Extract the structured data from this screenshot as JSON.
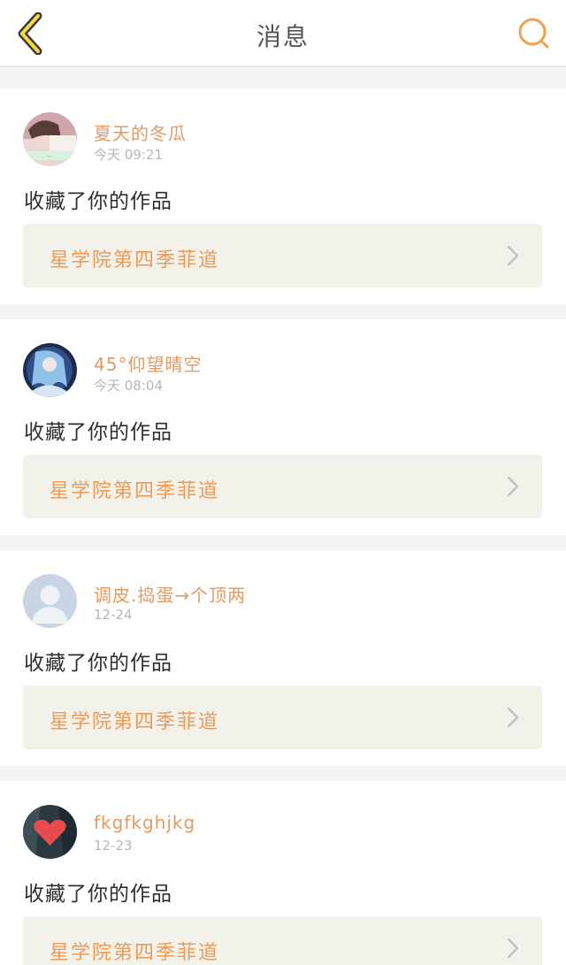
{
  "header": {
    "title": "消息",
    "back_icon": "chevron-left-icon",
    "search_icon": "search-icon",
    "accent_color": "#f2a04e"
  },
  "messages": [
    {
      "username": "夏天的冬瓜",
      "time": "今天 09:21",
      "action": "收藏了你的作品",
      "work_title": "星学院第四季菲道",
      "avatar": "photo-girl"
    },
    {
      "username": "45°仰望晴空",
      "time": "今天 08:04",
      "action": "收藏了你的作品",
      "work_title": "星学院第四季菲道",
      "avatar": "anime-character"
    },
    {
      "username": "调皮.捣蛋→个顶两",
      "time": "12-24",
      "action": "收藏了你的作品",
      "work_title": "星学院第四季菲道",
      "avatar": "default-user"
    },
    {
      "username": "fkgfkghjkg",
      "time": "12-23",
      "action": "收藏了你的作品",
      "work_title": "星学院第四季菲道",
      "avatar": "heart"
    }
  ]
}
